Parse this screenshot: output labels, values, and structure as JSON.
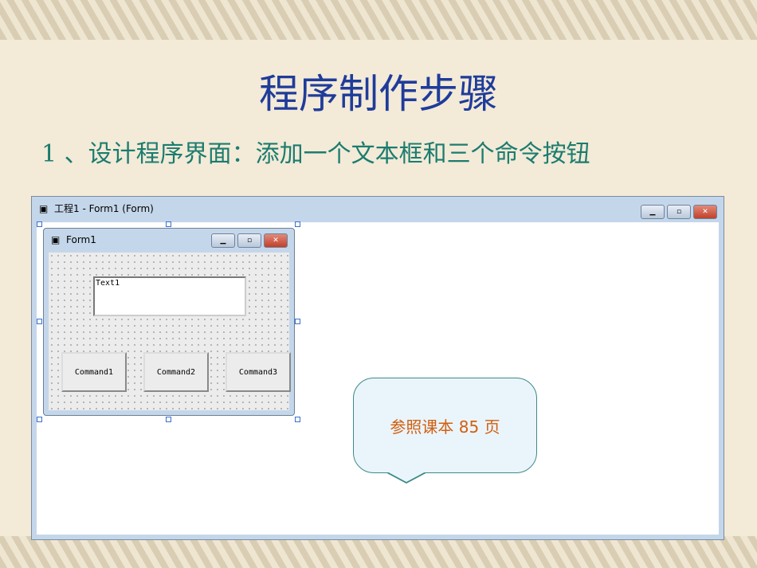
{
  "slide": {
    "title": "程序制作步骤",
    "subtitle": "1 、设计程序界面：添加一个文本框和三个命令按钮"
  },
  "ide": {
    "window_title": "工程1 - Form1 (Form)",
    "form_title": "Form1",
    "textbox": "Text1",
    "buttons": [
      "Command1",
      "Command2",
      "Command3"
    ],
    "caption_buttons": [
      "minimize",
      "maximize",
      "close"
    ]
  },
  "callout": {
    "text": "参照课本 85 页"
  }
}
